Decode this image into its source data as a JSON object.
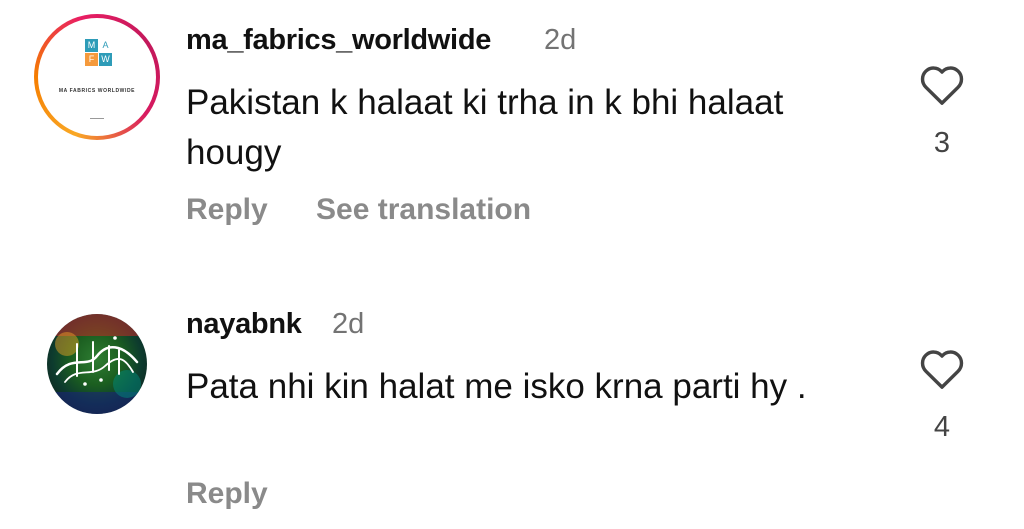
{
  "comments": [
    {
      "username": "ma_fabrics_worldwide",
      "time": "2d",
      "text": "Pakistan k halaat ki trha in k bhi halaat hougy",
      "avatar": {
        "logo_letters": [
          "M",
          "A",
          "F",
          "W"
        ],
        "logo_caption": "MA FABRICS WORLDWIDE",
        "logo_colors": [
          "#2e9cb8",
          "#f59a3c",
          "#f59a3c",
          "#2e9cb8"
        ]
      },
      "like_count": "3",
      "actions": {
        "reply": "Reply",
        "see_translation": "See translation"
      }
    },
    {
      "username": "nayabnk",
      "time": "2d",
      "text": "Pata nhi kin halat me isko krna parti hy .",
      "like_count": "4",
      "actions": {
        "reply": "Reply"
      }
    }
  ],
  "colors": {
    "primary_text": "#111111",
    "secondary_text": "#737373",
    "action_text": "#8a8a8a",
    "story_ring": [
      "#f9a825",
      "#e91e63"
    ]
  },
  "icons": {
    "like": "heart-outline-icon"
  }
}
